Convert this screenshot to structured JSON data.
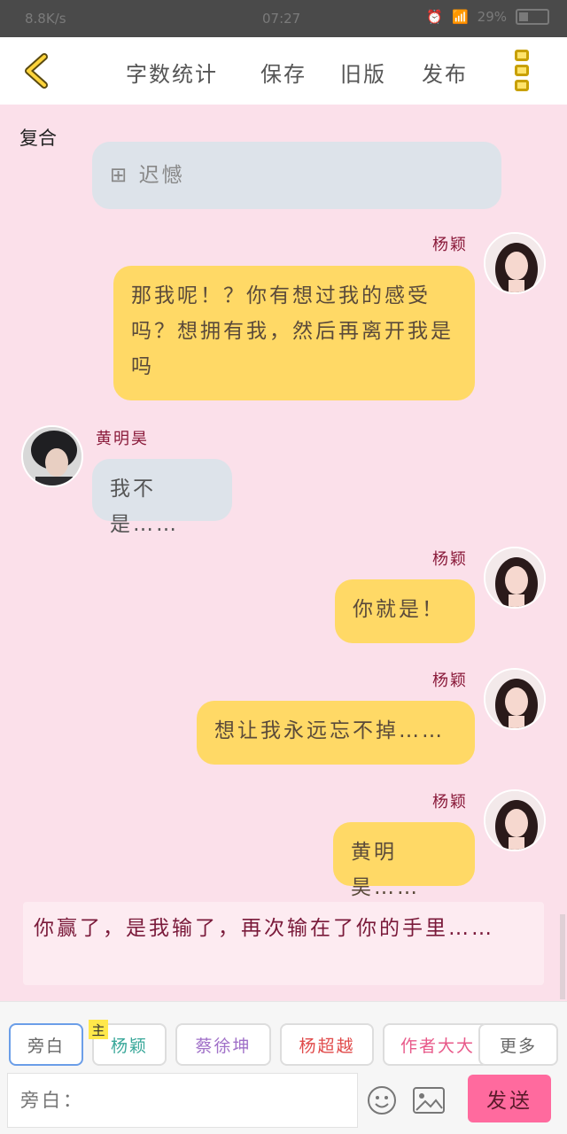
{
  "status_bar": {
    "net_speed": "8.8K/s",
    "time": "07:27",
    "battery": "29%"
  },
  "toolbar": {
    "word_count": "字数统计",
    "save": "保存",
    "old_version": "旧版",
    "publish": "发布"
  },
  "chat": {
    "title": "复合",
    "top_partial": "⊞ 迟憾",
    "messages": [
      {
        "speaker": "杨颖",
        "text": "那我呢！？你有想过我的感受吗？想拥有我，然后再离开我是吗"
      },
      {
        "speaker": "黄明昊",
        "text": "我不是……"
      },
      {
        "speaker": "杨颖",
        "text": "你就是！"
      },
      {
        "speaker": "杨颖",
        "text": "想让我永远忘不掉……"
      },
      {
        "speaker": "杨颖",
        "text": "黄明昊……"
      }
    ],
    "narration": "你赢了，是我输了，再次输在了你的手里……"
  },
  "roles": {
    "narrator": "旁白",
    "main_tag": "主",
    "items": [
      "杨颖",
      "蔡徐坤",
      "杨超越",
      "作者大大"
    ],
    "more": "更多"
  },
  "composer": {
    "placeholder": "旁白：",
    "send": "发送"
  },
  "colors": {
    "background": "#fbe0ea",
    "bubble_self": "#ffd966",
    "bubble_other": "#dde3ea",
    "send_button": "#ff6a9e",
    "name": "#8a1a3a"
  }
}
